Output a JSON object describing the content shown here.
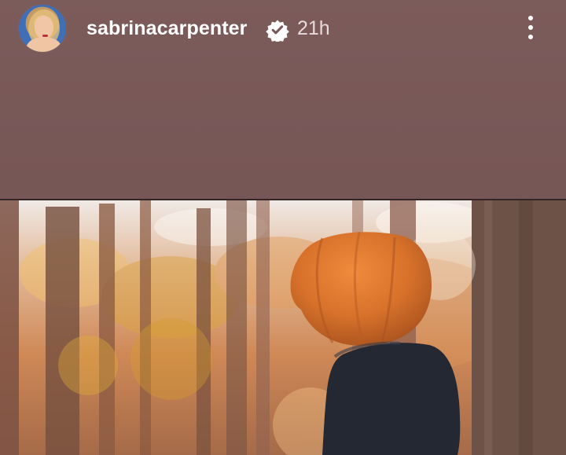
{
  "story": {
    "username": "sabrinacarpenter",
    "verified": true,
    "time": "21h",
    "avatar_icon": "avatar-profile-photo",
    "menu_icon": "more-vertical-icon",
    "colors": {
      "background": "#7a5a5a",
      "text": "#ffffff",
      "muted_text": "#e7dada",
      "pumpkin": "#d97528"
    }
  }
}
